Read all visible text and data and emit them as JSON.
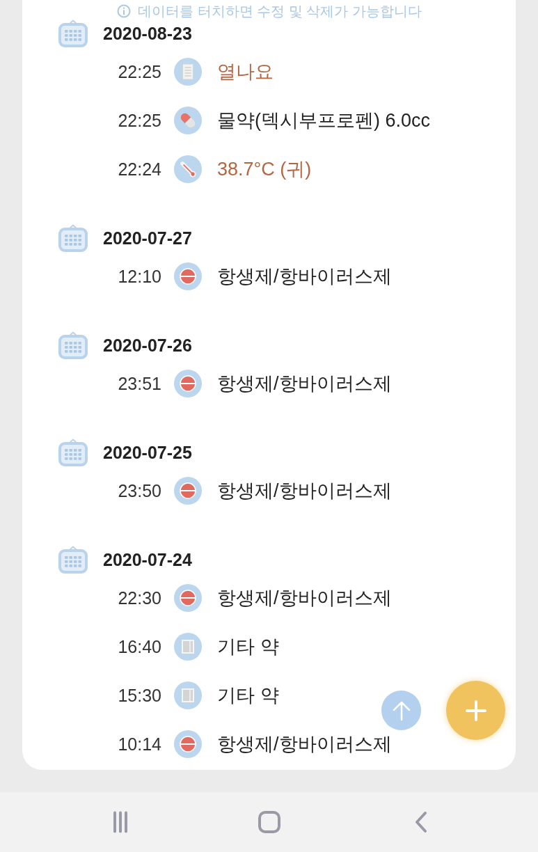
{
  "notice": {
    "text": "데이터를 터치하면 수정 및 삭제가 가능합니다"
  },
  "groups": [
    {
      "date": "2020-08-23",
      "entries": [
        {
          "time": "22:25",
          "kind": "note",
          "text": "열나요",
          "color": "#b5653f"
        },
        {
          "time": "22:25",
          "kind": "capsule",
          "text": "물약(덱시부프로펜) 6.0cc",
          "color": "#222222"
        },
        {
          "time": "22:24",
          "kind": "thermometer",
          "text": "38.7°C (귀)",
          "color": "#b5653f"
        }
      ]
    },
    {
      "date": "2020-07-27",
      "entries": [
        {
          "time": "12:10",
          "kind": "pill",
          "text": "항생제/항바이러스제",
          "color": "#222222"
        }
      ]
    },
    {
      "date": "2020-07-26",
      "entries": [
        {
          "time": "23:51",
          "kind": "pill",
          "text": "항생제/항바이러스제",
          "color": "#222222"
        }
      ]
    },
    {
      "date": "2020-07-25",
      "entries": [
        {
          "time": "23:50",
          "kind": "pill",
          "text": "항생제/항바이러스제",
          "color": "#222222"
        }
      ]
    },
    {
      "date": "2020-07-24",
      "entries": [
        {
          "time": "22:30",
          "kind": "pill",
          "text": "항생제/항바이러스제",
          "color": "#222222"
        },
        {
          "time": "16:40",
          "kind": "other",
          "text": "기타 약",
          "color": "#222222"
        },
        {
          "time": "15:30",
          "kind": "other",
          "text": "기타 약",
          "color": "#222222"
        },
        {
          "time": "10:14",
          "kind": "pill",
          "text": "항생제/항바이러스제",
          "color": "#222222"
        }
      ]
    }
  ]
}
